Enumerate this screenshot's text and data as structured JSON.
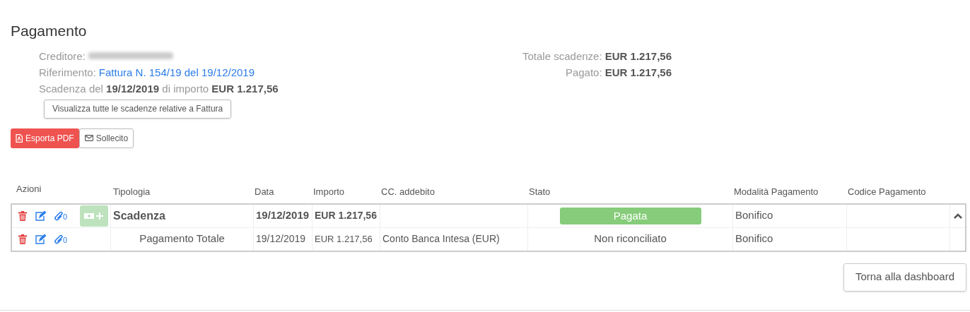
{
  "title": "Pagamento",
  "info": {
    "creditor_label": "Creditore:",
    "reference_label": "Riferimento:",
    "reference_link": "Fattura N. 154/19 del 19/12/2019",
    "due_text": "Scadenza del **19/12/2019** di importo **EUR 1.217,56**",
    "view_all_button": "Visualizza tutte le scadenze relative a Fattura"
  },
  "totals": [
    "Totale scadenze: **EUR 1.217,56**",
    "Pagato: **EUR 1.217,56**"
  ],
  "actions": [
    {
      "label": "Esporta PDF",
      "kind": "pdf"
    },
    {
      "label": "Sollecito",
      "kind": "mail"
    }
  ],
  "columns": [
    "Azioni",
    "Tipologia",
    "Data",
    "Importo",
    "CC. addebito",
    "Stato",
    "Modalità Pagamento",
    "Codice Pagamento"
  ],
  "rows": [
    {
      "kind": "due",
      "attachments": "0",
      "pay_disabled": true,
      "type": "Scadenza",
      "date": "19/12/2019",
      "amount": "EUR 1.217,56",
      "status": "Pagata",
      "status_badge": true,
      "method": "Bonifico",
      "expanded": true
    },
    {
      "kind": "payment",
      "attachments": "0",
      "type": "Pagamento Totale",
      "date": "19/12/2019",
      "amount": "EUR 1.217,56",
      "account": "Conto Banca Intesa (EUR)",
      "status": "Non riconciliato",
      "status_badge": false,
      "method": "Bonifico"
    }
  ],
  "back_button": "Torna alla dashboard"
}
